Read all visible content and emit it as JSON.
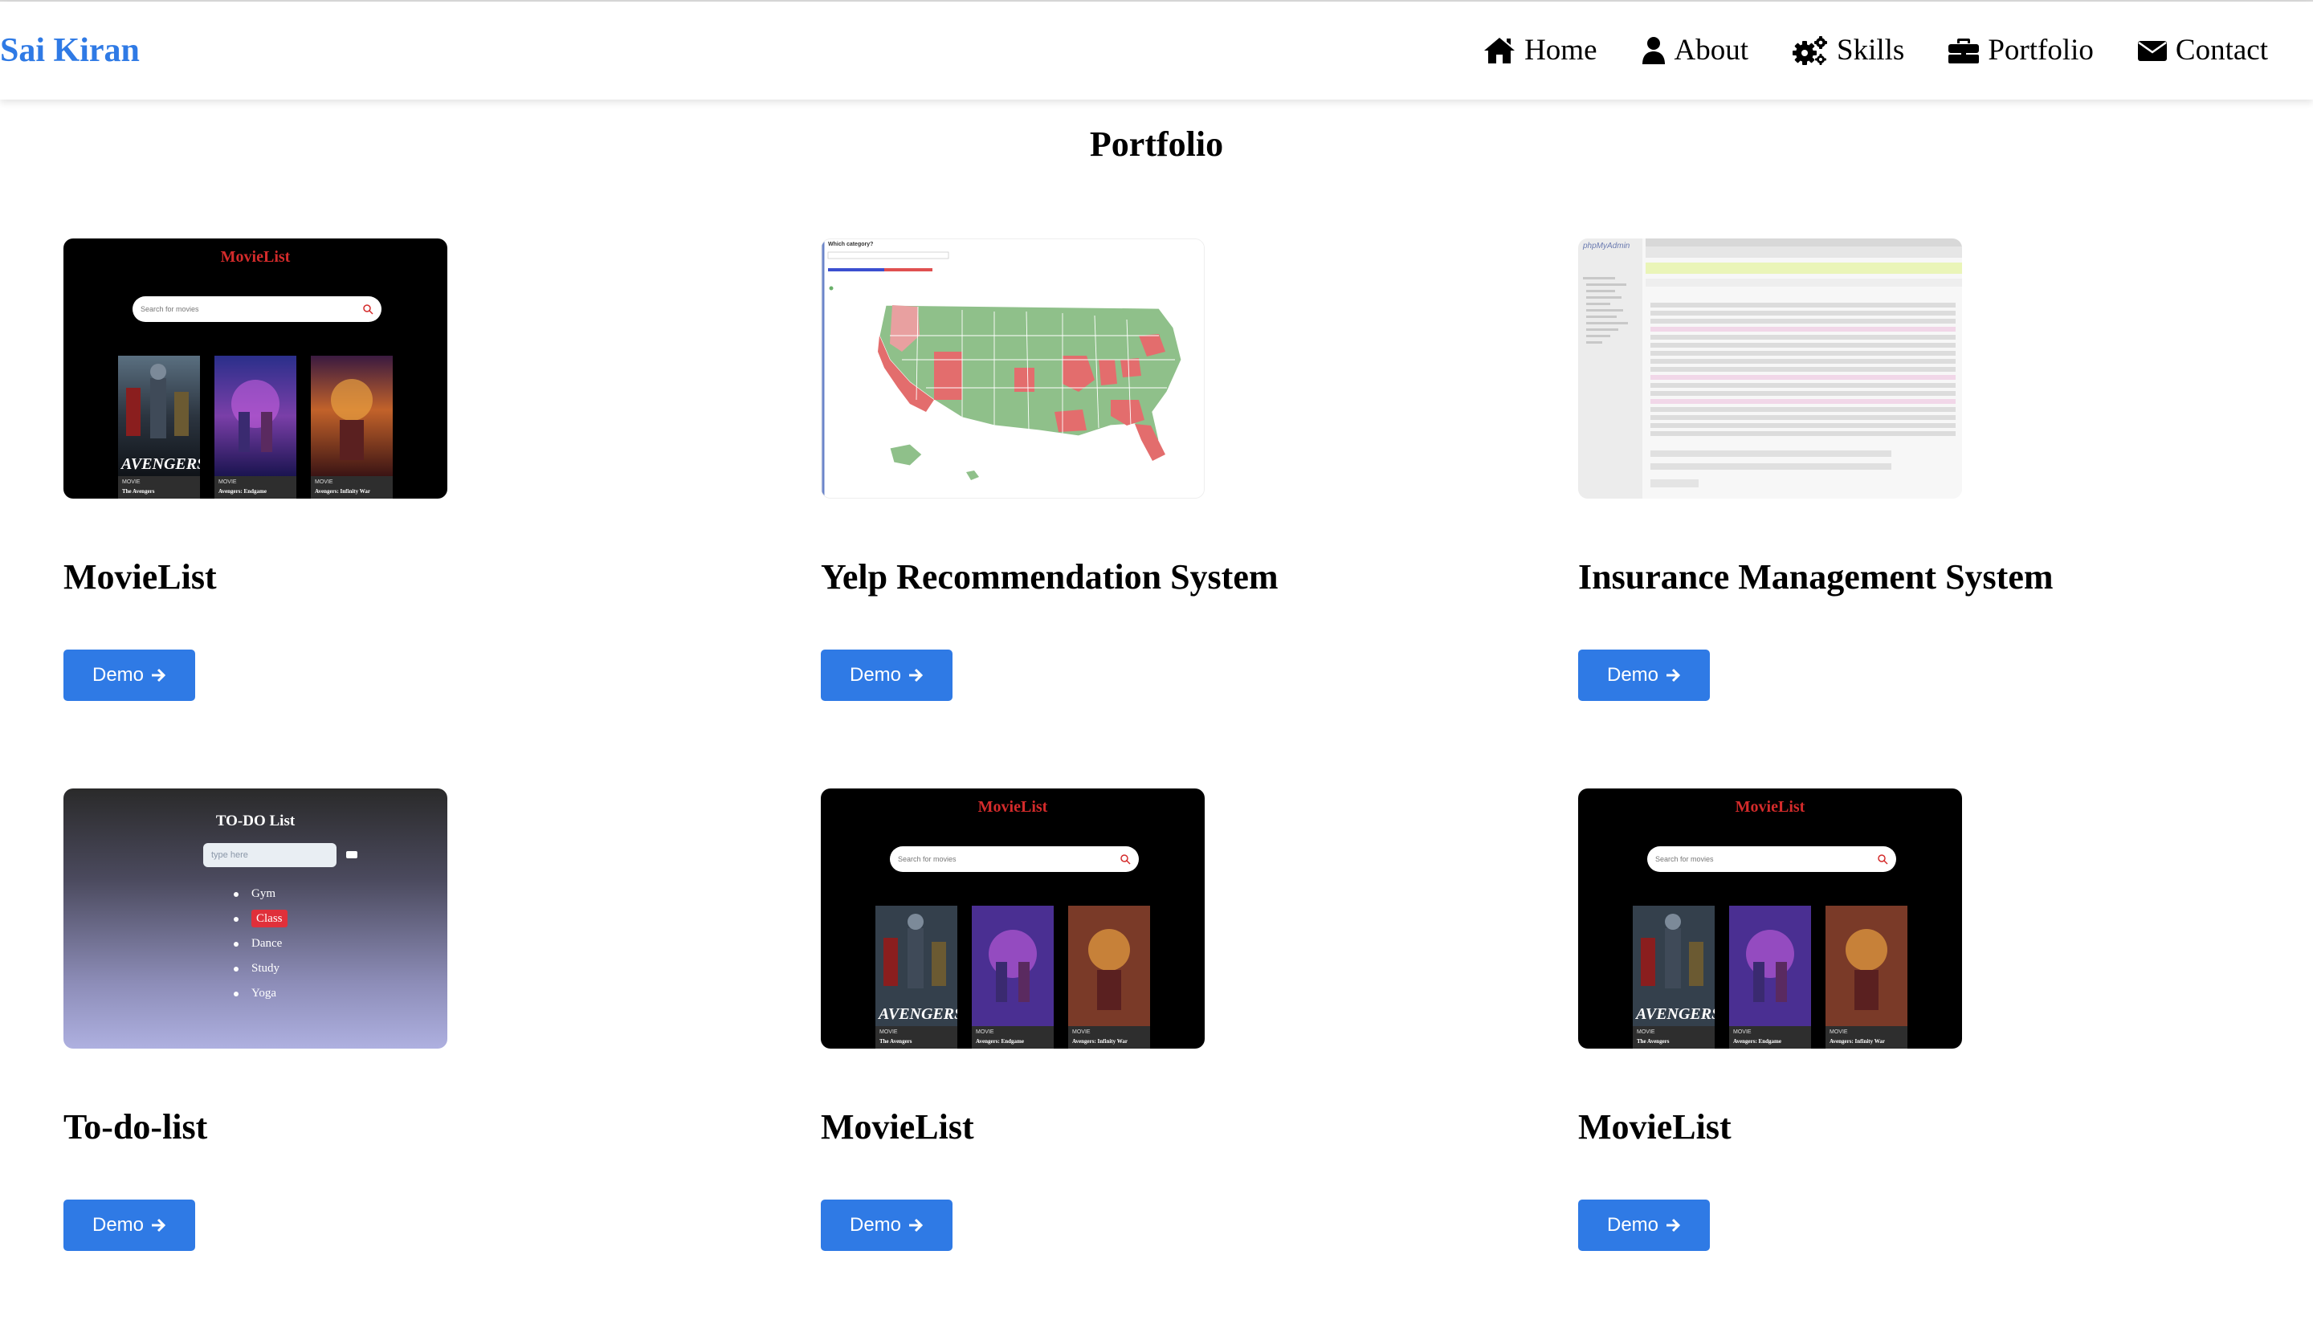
{
  "header": {
    "brand": "Sai Kiran",
    "nav": [
      {
        "label": "Home",
        "icon": "home-icon"
      },
      {
        "label": "About",
        "icon": "user-icon"
      },
      {
        "label": "Skills",
        "icon": "gears-icon"
      },
      {
        "label": "Portfolio",
        "icon": "briefcase-icon"
      },
      {
        "label": "Contact",
        "icon": "envelope-icon"
      }
    ]
  },
  "page": {
    "title": "Portfolio"
  },
  "colors": {
    "accent": "#2f7ae5",
    "brand": "#2f7ae5",
    "movie_logo": "#d42b2b",
    "todo_highlight": "#e0303a"
  },
  "projects": [
    {
      "title": "MovieList",
      "button": "Demo"
    },
    {
      "title": "Yelp Recommendation System",
      "button": "Demo"
    },
    {
      "title": "Insurance Management System",
      "button": "Demo"
    },
    {
      "title": "To-do-list",
      "button": "Demo"
    },
    {
      "title": "MovieList",
      "button": "Demo"
    },
    {
      "title": "MovieList",
      "button": "Demo"
    }
  ],
  "movie_thumb": {
    "logo": "MovieList",
    "search_placeholder": "Search for movies",
    "posters": [
      {
        "type": "MOVIE",
        "name": "The Avengers",
        "art": "AVENGERS"
      },
      {
        "type": "MOVIE",
        "name": "Avengers: Endgame"
      },
      {
        "type": "MOVIE",
        "name": "Avengers: Infinity War"
      }
    ]
  },
  "yelp_thumb": {
    "question": "Which category?"
  },
  "todo_thumb": {
    "title": "TO-DO List",
    "placeholder": "type here",
    "items": [
      "Gym",
      "Class",
      "Dance",
      "Study",
      "Yoga"
    ]
  },
  "insurance_thumb": {
    "app_name": "phpMyAdmin"
  }
}
